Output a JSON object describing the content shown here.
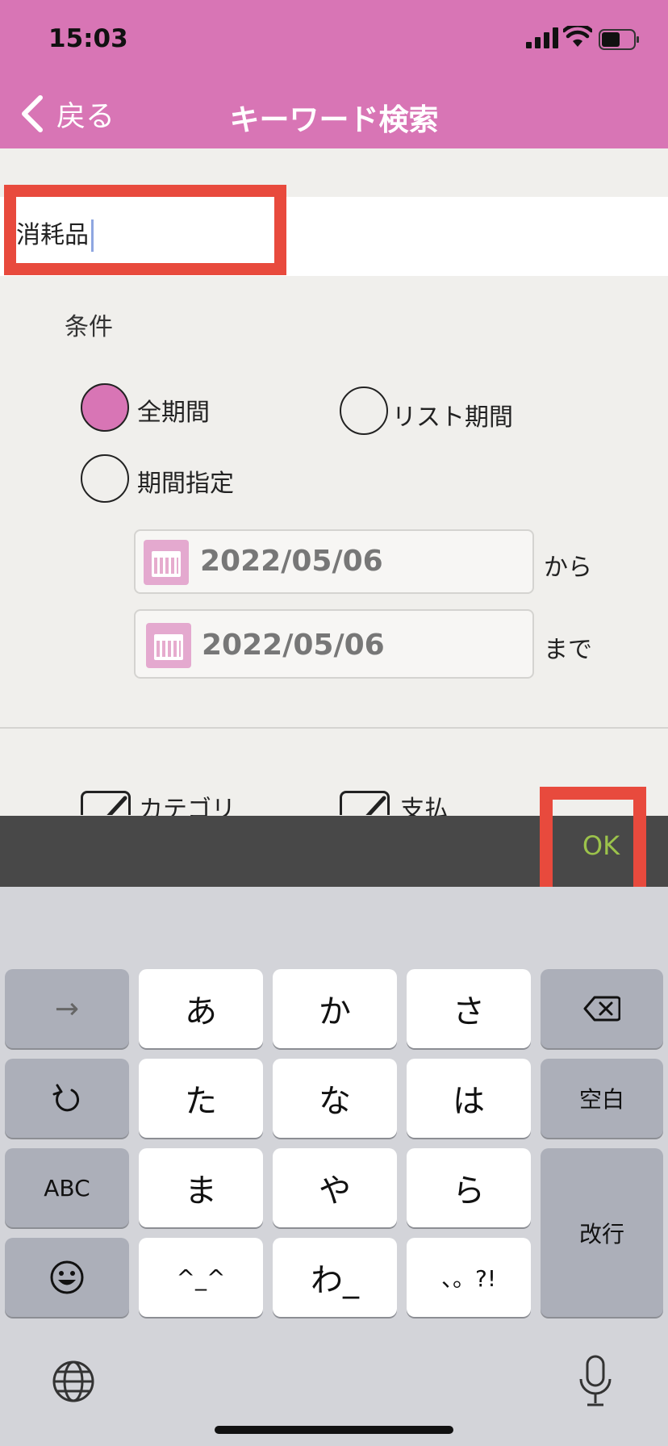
{
  "status": {
    "time": "15:03"
  },
  "nav": {
    "back_label": "戻る",
    "title": "キーワード検索"
  },
  "search": {
    "value": "消耗品"
  },
  "conditions": {
    "label": "条件",
    "options": [
      {
        "label": "全期間",
        "selected": true
      },
      {
        "label": "リスト期間",
        "selected": false
      },
      {
        "label": "期間指定",
        "selected": false
      }
    ],
    "date_from": {
      "value": "2022/05/06",
      "suffix": "から"
    },
    "date_to": {
      "value": "2022/05/06",
      "suffix": "まで"
    }
  },
  "filters": [
    {
      "label": "カテゴリ",
      "checked": true
    },
    {
      "label": "支払",
      "checked": true
    }
  ],
  "toolbar": {
    "ok_label": "OK"
  },
  "keyboard": {
    "rows": [
      [
        "→",
        "あ",
        "か",
        "さ",
        "delete-icon"
      ],
      [
        "undo-icon",
        "た",
        "な",
        "は",
        "空白"
      ],
      [
        "ABC",
        "ま",
        "や",
        "ら",
        "改行"
      ],
      [
        "emoji-icon",
        "^_^",
        "わ_",
        "、。?!"
      ]
    ],
    "labels": {
      "arrow": "→",
      "a": "あ",
      "ka": "か",
      "sa": "さ",
      "ta": "た",
      "na": "な",
      "ha": "は",
      "space": "空白",
      "abc": "ABC",
      "ma": "ま",
      "ya": "や",
      "ra": "ら",
      "return": "改行",
      "kaomoji": "^_^",
      "wa": "わ_",
      "punct": "、。?!"
    }
  },
  "colors": {
    "accent": "#d875b5",
    "highlight": "#e84a3d",
    "ok": "#9cc34b",
    "toolbar": "#484848"
  }
}
